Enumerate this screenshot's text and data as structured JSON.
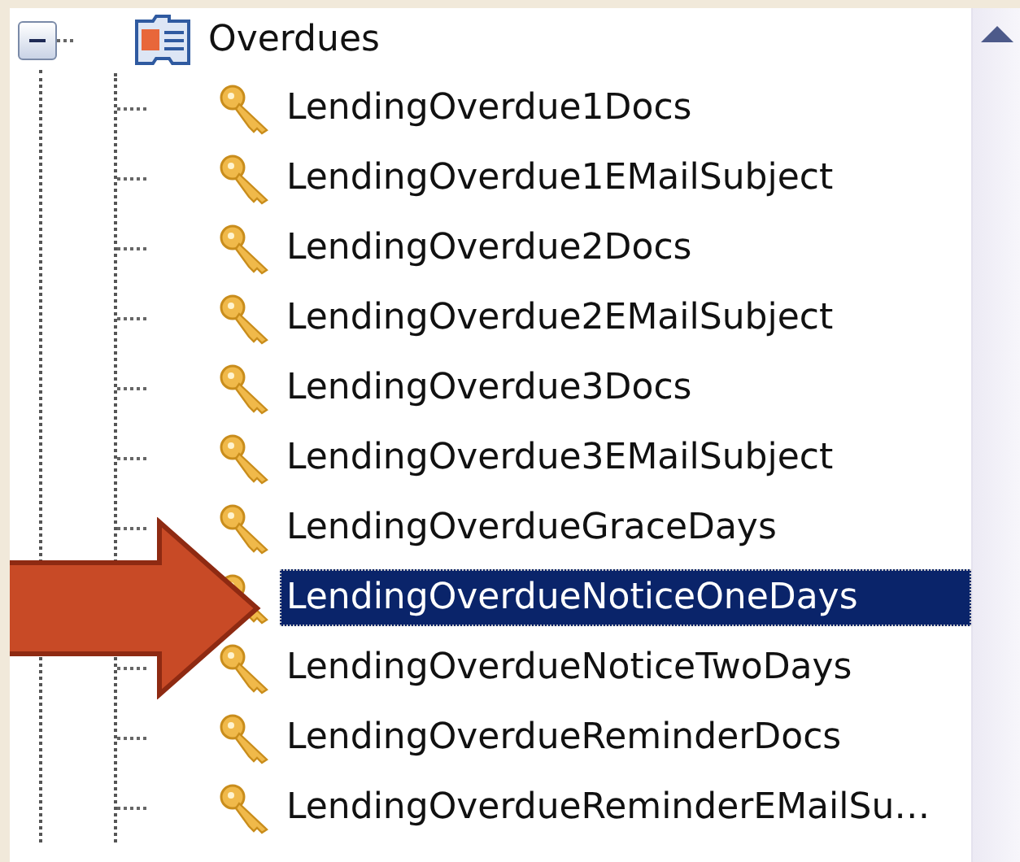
{
  "tree": {
    "label": "Overdues",
    "expanded": true,
    "children": [
      {
        "label": "LendingOverdue1Docs",
        "selected": false
      },
      {
        "label": "LendingOverdue1EMailSubject",
        "selected": false
      },
      {
        "label": "LendingOverdue2Docs",
        "selected": false
      },
      {
        "label": "LendingOverdue2EMailSubject",
        "selected": false
      },
      {
        "label": "LendingOverdue3Docs",
        "selected": false
      },
      {
        "label": "LendingOverdue3EMailSubject",
        "selected": false
      },
      {
        "label": "LendingOverdueGraceDays",
        "selected": false
      },
      {
        "label": "LendingOverdueNoticeOneDays",
        "selected": true
      },
      {
        "label": "LendingOverdueNoticeTwoDays",
        "selected": false
      },
      {
        "label": "LendingOverdueReminderDocs",
        "selected": false
      },
      {
        "label": "LendingOverdueReminderEMailSu…",
        "selected": false
      }
    ]
  }
}
